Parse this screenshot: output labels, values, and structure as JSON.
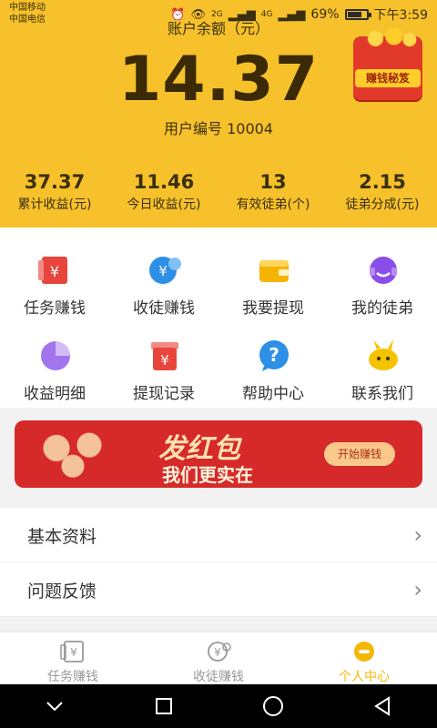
{
  "status_bar": {
    "carrier1": "中国移动",
    "carrier2": "中国电信",
    "battery": "69%",
    "battery_level": 0.69,
    "time": "下午3:59",
    "net1": "2G",
    "net2": "4G"
  },
  "header": {
    "balance_label": "账户余额（元）",
    "balance_value": "14.37",
    "user_id": "用户编号 10004",
    "promo_tag": "赚钱秘笈",
    "stats": [
      {
        "value": "37.37",
        "label": "累计收益(元)"
      },
      {
        "value": "11.46",
        "label": "今日收益(元)"
      },
      {
        "value": "13",
        "label": "有效徒弟(个)"
      },
      {
        "value": "2.15",
        "label": "徒弟分成(元)"
      }
    ]
  },
  "grid": [
    {
      "label": "任务赚钱",
      "icon": "task-money-icon"
    },
    {
      "label": "收徒赚钱",
      "icon": "recruit-money-icon"
    },
    {
      "label": "我要提现",
      "icon": "wallet-icon"
    },
    {
      "label": "我的徒弟",
      "icon": "disciple-icon"
    },
    {
      "label": "收益明细",
      "icon": "pie-chart-icon"
    },
    {
      "label": "提现记录",
      "icon": "record-icon"
    },
    {
      "label": "帮助中心",
      "icon": "help-icon"
    },
    {
      "label": "联系我们",
      "icon": "contact-icon"
    }
  ],
  "banner": {
    "title": "发红包",
    "subtitle": "我们更实在",
    "button": "开始赚钱"
  },
  "menu": [
    {
      "label": "基本资料"
    },
    {
      "label": "问题反馈"
    }
  ],
  "tabbar": [
    {
      "label": "任务赚钱",
      "active": false
    },
    {
      "label": "收徒赚钱",
      "active": false
    },
    {
      "label": "个人中心",
      "active": true
    }
  ],
  "colors": {
    "header_bg": "#f6c12a",
    "accent": "#f5b800",
    "red": "#e23a2a"
  }
}
